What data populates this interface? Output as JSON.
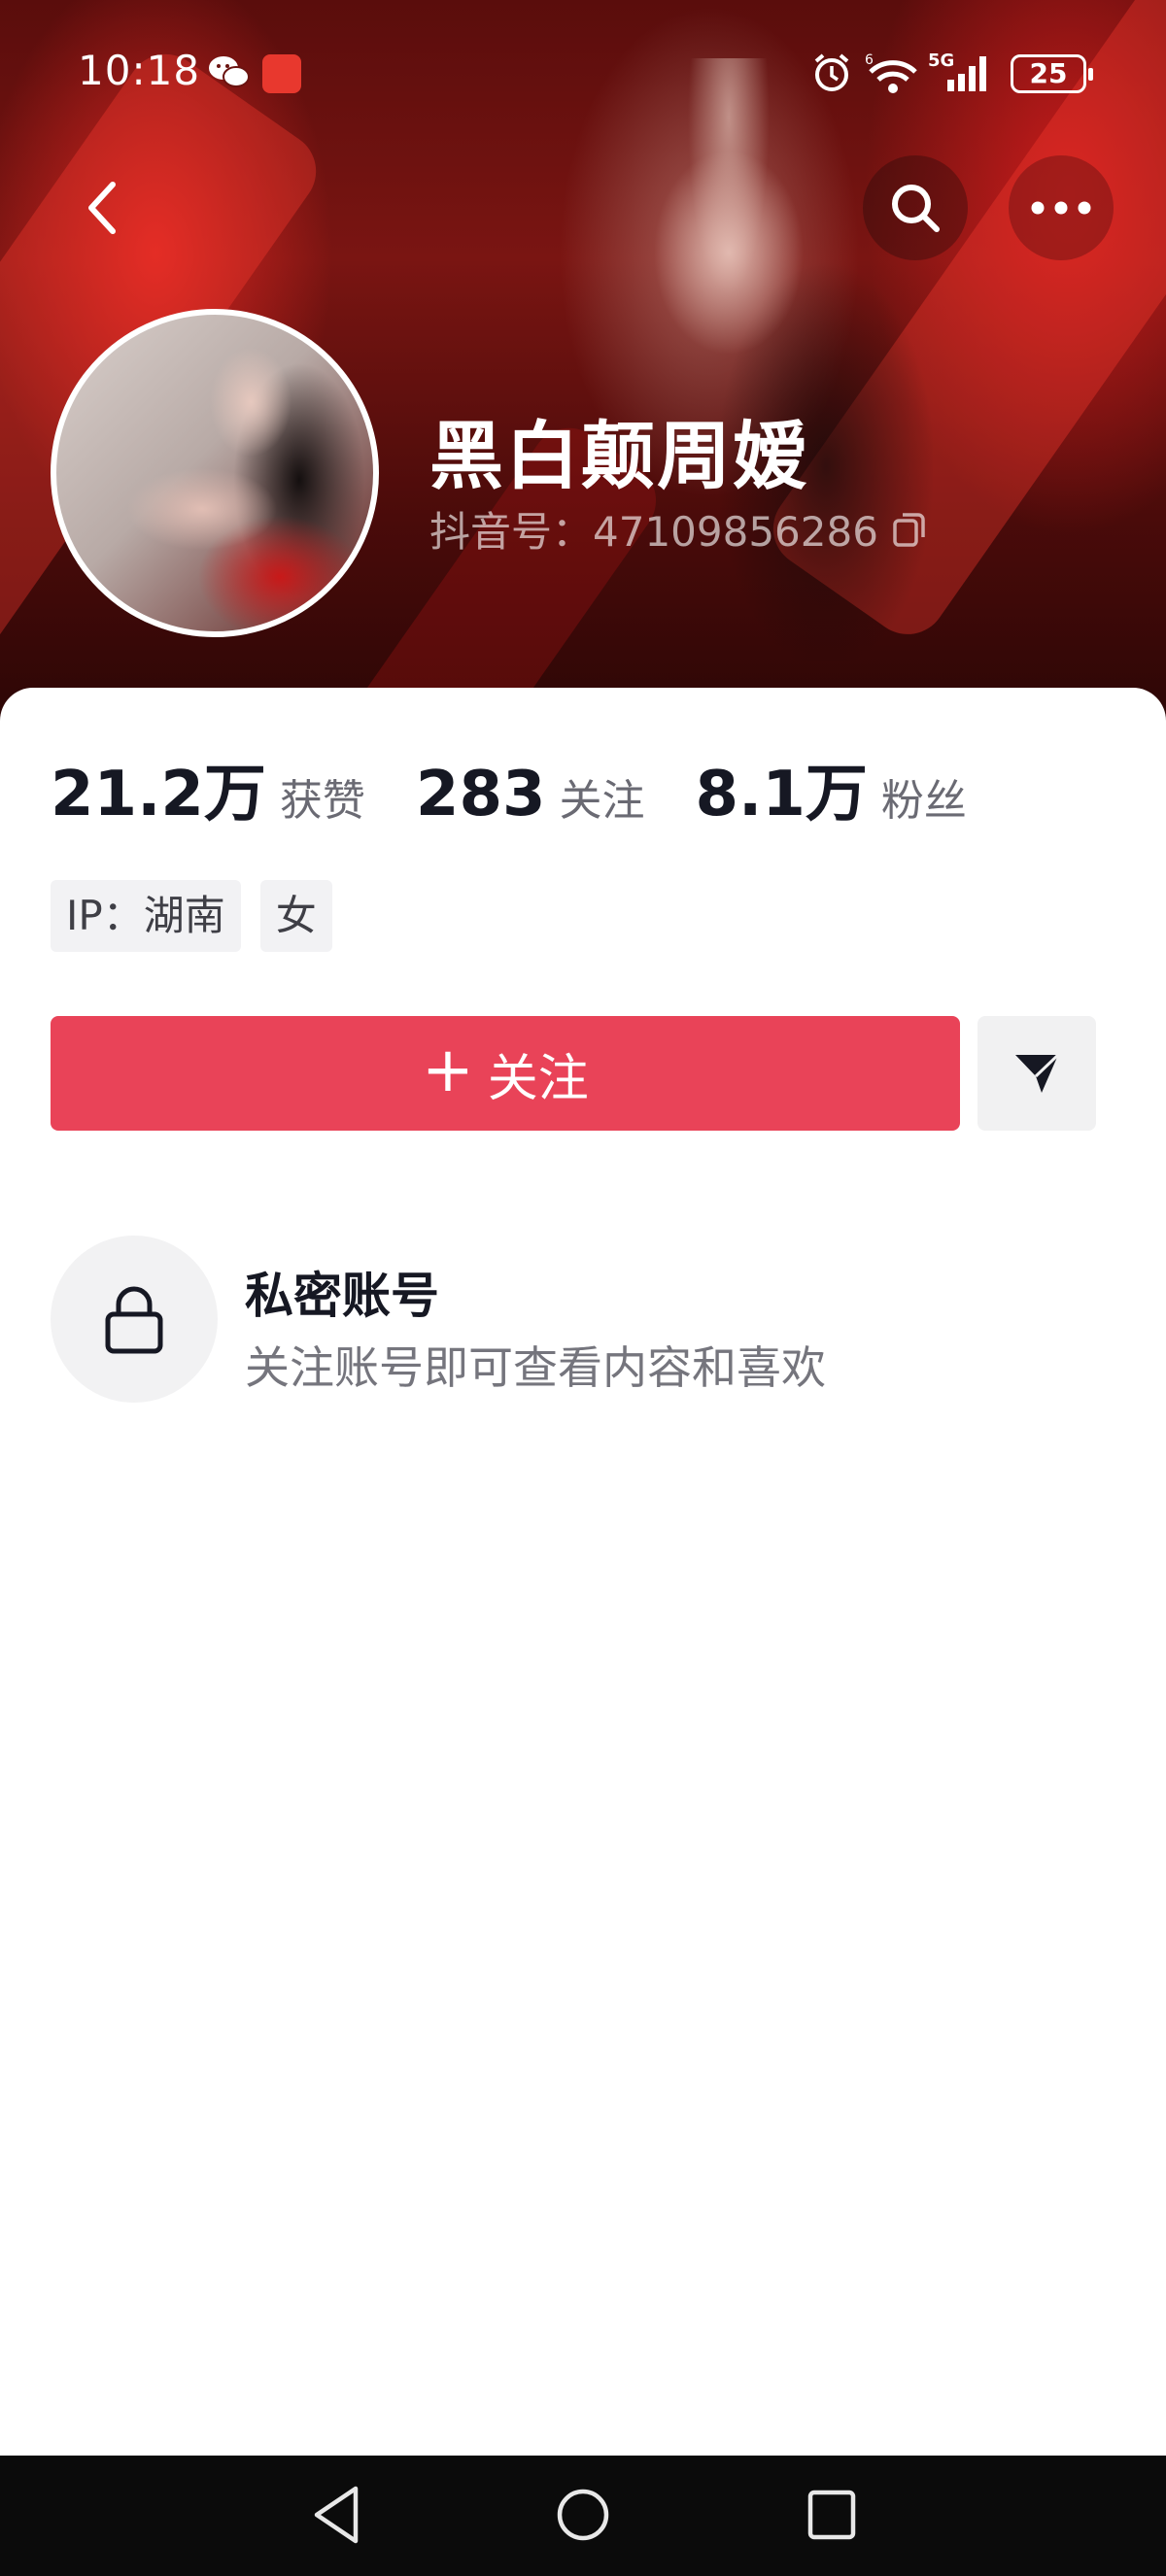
{
  "status_bar": {
    "time": "10:18",
    "network": "5G",
    "wifi_badge": "6",
    "battery": "25"
  },
  "profile": {
    "name": "黑白颠周嫒",
    "douyin_id": "抖音号：47109856286"
  },
  "stats": [
    {
      "value": "21.2万",
      "label": "获赞"
    },
    {
      "value": "283",
      "label": "关注"
    },
    {
      "value": "8.1万",
      "label": "粉丝"
    }
  ],
  "tags": [
    "IP：湖南",
    "女"
  ],
  "actions": {
    "follow_plus": "+",
    "follow_label": "关注"
  },
  "private_account": {
    "title": "私密账号",
    "description": "关注账号即可查看内容和喜欢"
  },
  "colors": {
    "follow_button": "#e94358",
    "banner_red": "#7a1512"
  },
  "icons": [
    "wechat-icon",
    "alarm-icon",
    "wifi-icon",
    "signal-icon",
    "back-icon",
    "search-icon",
    "more-icon",
    "copy-icon",
    "share-icon",
    "lock-icon"
  ]
}
